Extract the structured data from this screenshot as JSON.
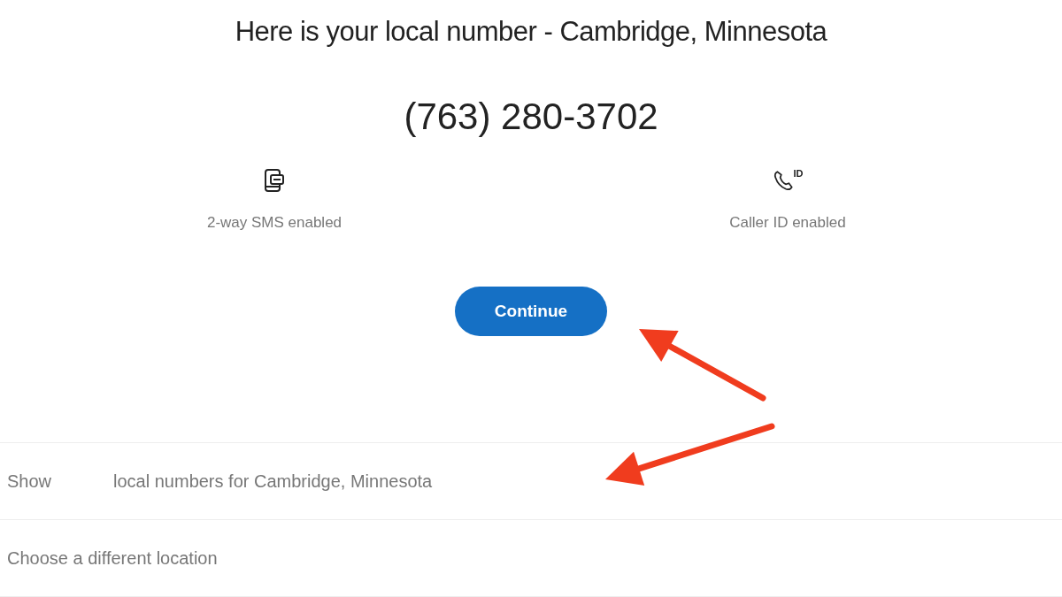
{
  "heading": "Here is your local number - Cambridge, Minnesota",
  "number": "(763) 280-3702",
  "features": [
    {
      "kind": "sms",
      "label": "2-way SMS enabled"
    },
    {
      "kind": "caller",
      "badge": "ID",
      "label": "Caller ID enabled"
    }
  ],
  "button": "Continue",
  "options": [
    {
      "parts": [
        "Show",
        "local numbers for Cambridge, Minnesota"
      ]
    },
    {
      "parts": [
        "Choose a different location"
      ]
    }
  ],
  "annotations": [
    {
      "kind": "arrow"
    },
    {
      "kind": "arrow"
    }
  ]
}
